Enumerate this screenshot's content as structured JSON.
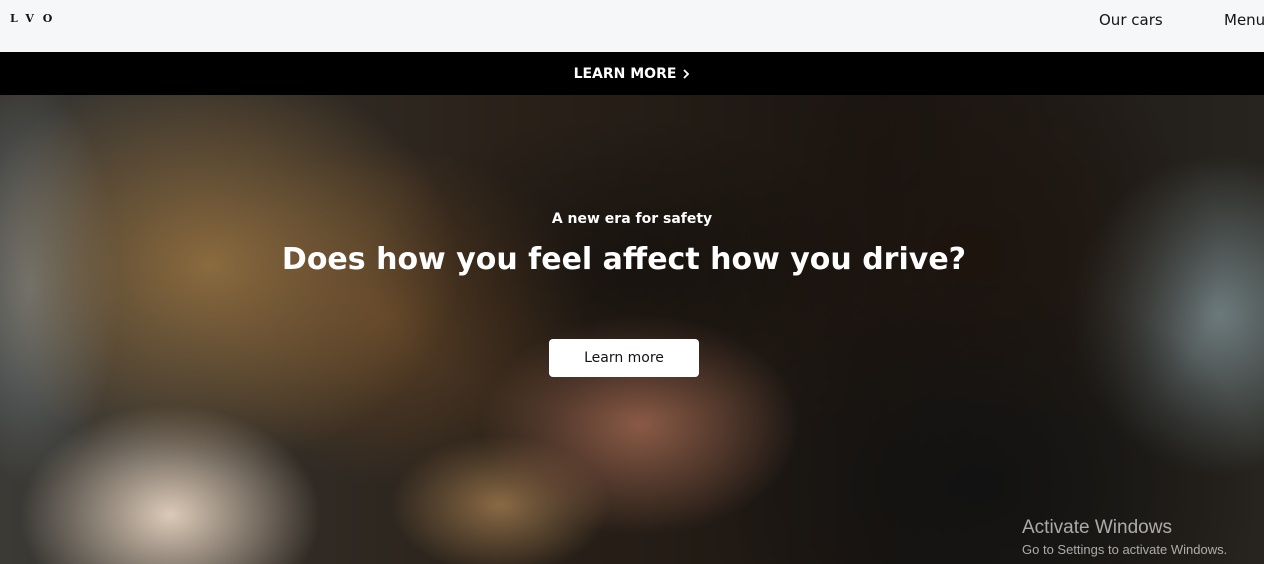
{
  "header": {
    "logo_text": "LVO",
    "nav": {
      "our_cars": "Our cars",
      "menu": "Menu"
    }
  },
  "promo": {
    "label": "LEARN MORE",
    "icon": "chevron-right-icon"
  },
  "hero": {
    "eyebrow": "A new era for safety",
    "title": "Does how you feel affect how you drive?",
    "button_label": "Learn more"
  },
  "overlay": {
    "title": "Activate Windows",
    "subtitle": "Go to Settings to activate Windows."
  },
  "colors": {
    "header_bg": "#f6f7f9",
    "promo_bg": "#000000",
    "text_dark": "#141414",
    "text_light": "#ffffff"
  }
}
